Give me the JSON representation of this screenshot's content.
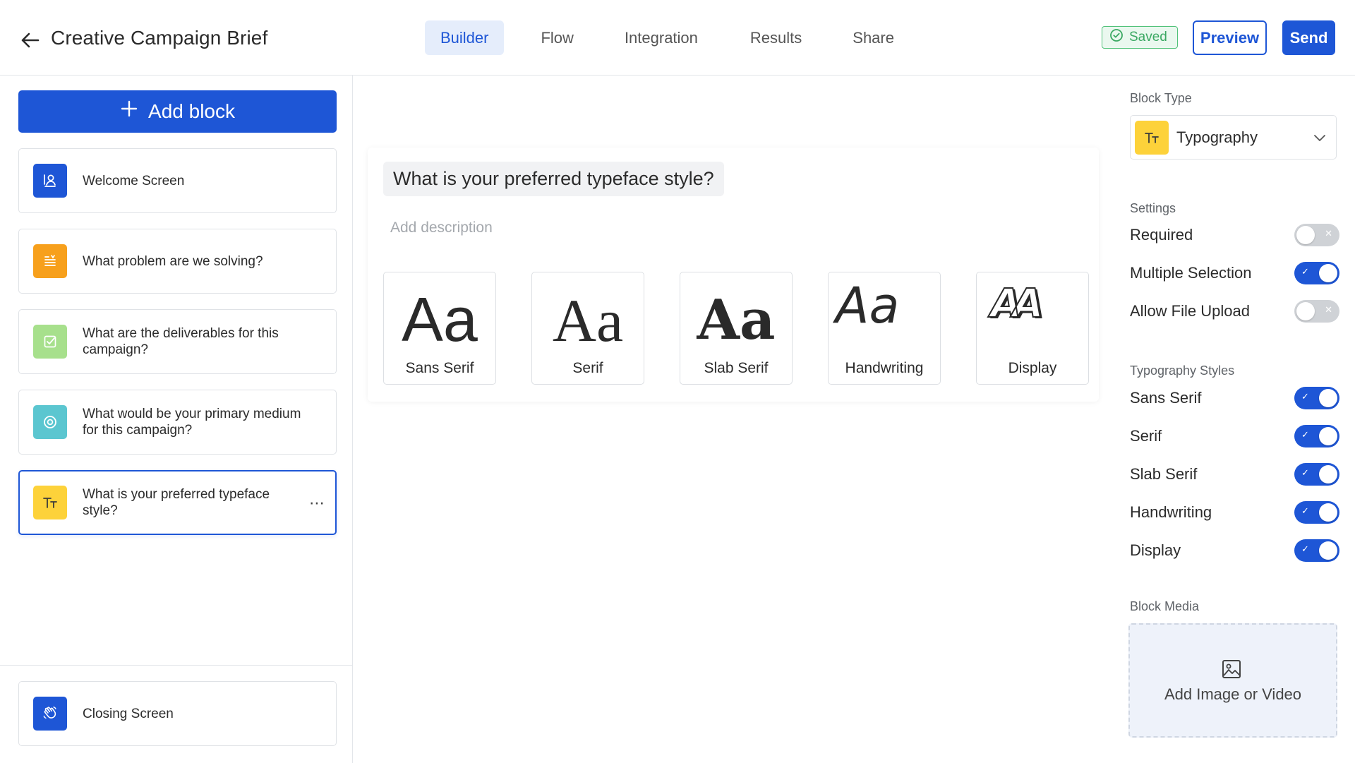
{
  "header": {
    "title": "Creative Campaign Brief",
    "tabs": [
      {
        "label": "Builder",
        "active": true
      },
      {
        "label": "Flow",
        "active": false
      },
      {
        "label": "Integration",
        "active": false
      },
      {
        "label": "Results",
        "active": false
      },
      {
        "label": "Share",
        "active": false
      }
    ],
    "saved_label": "Saved",
    "preview_label": "Preview",
    "send_label": "Send"
  },
  "sidebar": {
    "add_block_label": "Add block",
    "blocks": [
      {
        "label": "Welcome Screen",
        "icon": "welcome-icon",
        "color": "#1e56d6"
      },
      {
        "label": "What problem are we solving?",
        "icon": "text-lines-icon",
        "color": "#f7a01c"
      },
      {
        "label": "What are the deliverables for this campaign?",
        "icon": "checkbox-icon",
        "color": "#a7e08c"
      },
      {
        "label": "What would be your primary medium for this campaign?",
        "icon": "radio-icon",
        "color": "#5bc6d0"
      },
      {
        "label": "What is your preferred typeface style?",
        "icon": "typography-icon",
        "color": "#fdd23a",
        "selected": true
      }
    ],
    "closing_block": {
      "label": "Closing Screen",
      "icon": "wave-hand-icon",
      "color": "#1e56d6"
    }
  },
  "canvas": {
    "question_title": "What is your preferred typeface style?",
    "description_placeholder": "Add description",
    "options": [
      {
        "sample": "Aa",
        "label": "Sans Serif"
      },
      {
        "sample": "Aa",
        "label": "Serif"
      },
      {
        "sample": "Aa",
        "label": "Slab Serif"
      },
      {
        "sample": "Aa",
        "label": "Handwriting"
      },
      {
        "sample": "AA",
        "label": "Display"
      }
    ]
  },
  "right_panel": {
    "block_type_title": "Block Type",
    "block_type_value": "Typography",
    "settings_title": "Settings",
    "settings": [
      {
        "label": "Required",
        "on": false
      },
      {
        "label": "Multiple Selection",
        "on": true
      },
      {
        "label": "Allow File Upload",
        "on": false
      }
    ],
    "styles_title": "Typography Styles",
    "styles": [
      {
        "label": "Sans Serif",
        "on": true
      },
      {
        "label": "Serif",
        "on": true
      },
      {
        "label": "Slab Serif",
        "on": true
      },
      {
        "label": "Handwriting",
        "on": true
      },
      {
        "label": "Display",
        "on": true
      }
    ],
    "media_title": "Block Media",
    "media_label": "Add Image or Video"
  },
  "colors": {
    "accent": "#1e56d6",
    "success": "#3aa862",
    "typography_yellow": "#fdd23a"
  }
}
